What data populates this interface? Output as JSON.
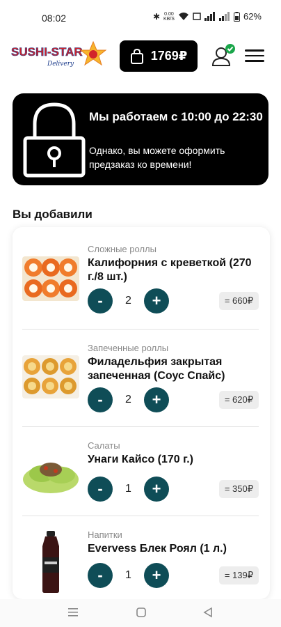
{
  "status_bar": {
    "time": "08:02",
    "data_speed": "0.00\nKB/S",
    "battery": "62%"
  },
  "header": {
    "logo_text_top": "SUSHI-STAR",
    "logo_text_sub": "Delivery",
    "cart_total": "1769₽",
    "colors": {
      "cart_bg": "#000000",
      "accent_green": "#1aa64a"
    }
  },
  "banner": {
    "title": "Мы работаем с 10:00 до 22:30",
    "subtitle": "Однако, вы можете оформить предзаказ ко времени!"
  },
  "cart": {
    "section_title": "Вы добавили",
    "items": [
      {
        "category": "Сложные роллы",
        "name": "Калифорния с креветкой (270 г./8 шт.)",
        "minus": "-",
        "quantity": "2",
        "plus": "+",
        "price": "= 660₽"
      },
      {
        "category": "Запеченные роллы",
        "name": "Филадельфия закрытая запеченная (Соус Спайс)",
        "minus": "-",
        "quantity": "2",
        "plus": "+",
        "price": "= 620₽"
      },
      {
        "category": "Салаты",
        "name": "Унаги Кайсо (170 г.)",
        "minus": "-",
        "quantity": "1",
        "plus": "+",
        "price": "= 350₽"
      },
      {
        "category": "Напитки",
        "name": "Evervess Блек Роял (1 л.)",
        "minus": "-",
        "quantity": "1",
        "plus": "+",
        "price": "= 139₽"
      }
    ],
    "colors": {
      "qty_button": "#0f4d57"
    }
  },
  "nav_bar": {
    "icons": [
      "menu-lines-icon",
      "home-square-icon",
      "back-triangle-icon"
    ]
  }
}
